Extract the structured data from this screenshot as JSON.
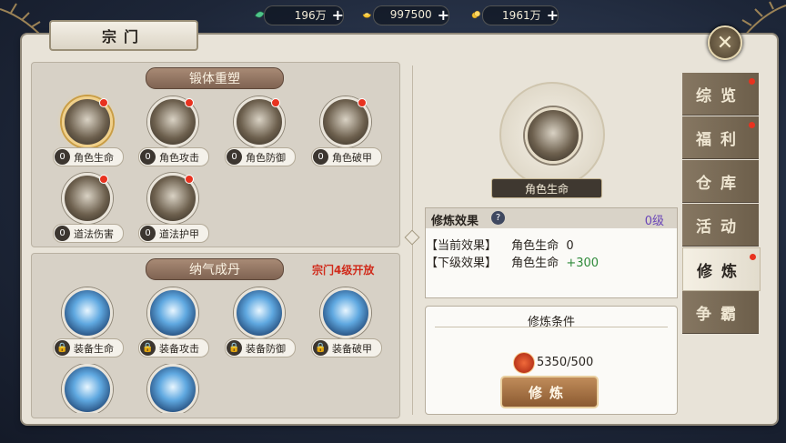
{
  "currency": [
    {
      "icon": "jade-icon",
      "value": "196万",
      "plus": "+"
    },
    {
      "icon": "gold-ingot-icon",
      "value": "997500",
      "plus": "+"
    },
    {
      "icon": "coin-icon",
      "value": "1961万",
      "plus": "+"
    }
  ],
  "window": {
    "title": "宗门",
    "close": "✕"
  },
  "left": {
    "section1": {
      "title": "锻体重塑",
      "skills": [
        {
          "label": "角色生命",
          "level": "0"
        },
        {
          "label": "角色攻击",
          "level": "0"
        },
        {
          "label": "角色防御",
          "level": "0"
        },
        {
          "label": "角色破甲",
          "level": "0"
        },
        {
          "label": "道法伤害",
          "level": "0"
        },
        {
          "label": "道法护甲",
          "level": "0"
        }
      ]
    },
    "section2": {
      "title": "纳气成丹",
      "unlock_text": "宗门4级开放",
      "skills": [
        {
          "label": "装备生命"
        },
        {
          "label": "装备攻击"
        },
        {
          "label": "装备防御"
        },
        {
          "label": "装备破甲"
        }
      ]
    }
  },
  "right": {
    "selected_name": "角色生命",
    "effect": {
      "title": "修炼效果",
      "help": "?",
      "level": "0级",
      "current_label": "【当前效果】",
      "current_attr": "角色生命",
      "current_val": "0",
      "next_label": "【下级效果】",
      "next_attr": "角色生命",
      "next_val": "+300"
    },
    "condition": {
      "title": "修炼条件",
      "resource": "5350/500",
      "button": "修炼"
    }
  },
  "sidebar": {
    "tabs": [
      {
        "label": "综览",
        "dot": true
      },
      {
        "label": "福利",
        "dot": true
      },
      {
        "label": "仓库",
        "dot": false
      },
      {
        "label": "活动",
        "dot": false
      },
      {
        "label": "修炼",
        "dot": true,
        "active": true
      },
      {
        "label": "争霸",
        "dot": false
      }
    ]
  },
  "colors": {
    "accent_red": "#d02a1a",
    "level_purple": "#6a45b8",
    "next_green": "#2e8a3a"
  }
}
